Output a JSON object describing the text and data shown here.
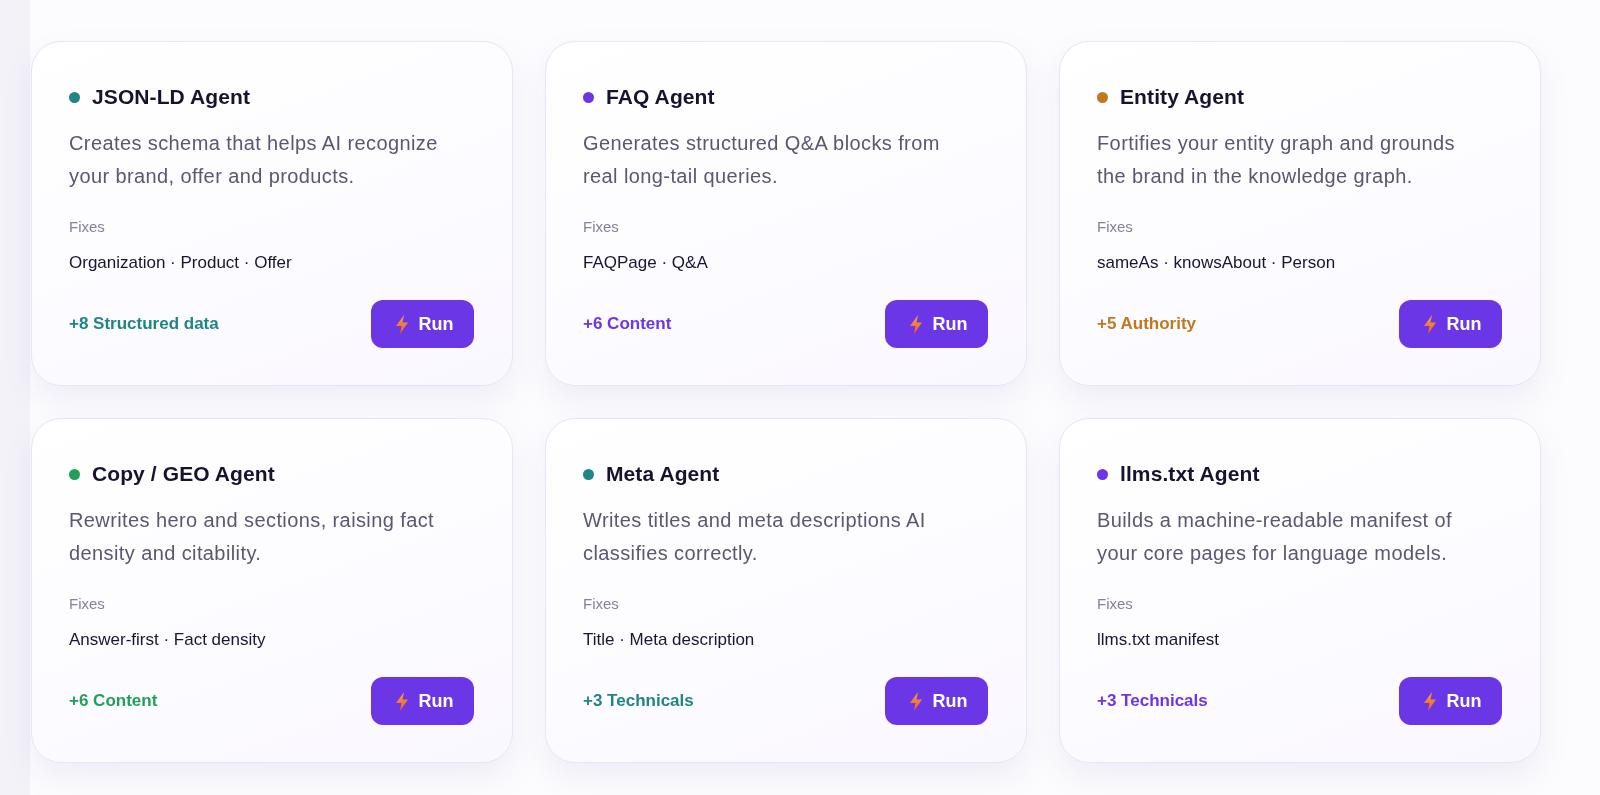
{
  "agents": [
    {
      "name": "JSON-LD Agent",
      "color": "#1f8585",
      "description": "Creates schema that helps AI recognize your brand, offer and products.",
      "fixes_label": "Fixes",
      "fixes": "Organization · Product · Offer",
      "impact": "+8 Structured data",
      "button": "Run"
    },
    {
      "name": "FAQ Agent",
      "color": "#6d35e8",
      "description": "Generates structured Q&A blocks from real long-tail queries.",
      "fixes_label": "Fixes",
      "fixes": "FAQPage · Q&A",
      "impact": "+6 Content",
      "button": "Run"
    },
    {
      "name": "Entity Agent",
      "color": "#c0781e",
      "description": "Fortifies your entity graph and grounds the brand in the knowledge graph.",
      "fixes_label": "Fixes",
      "fixes": "sameAs · knowsAbout · Person",
      "impact": "+5 Authority",
      "button": "Run"
    },
    {
      "name": "Copy / GEO Agent",
      "color": "#22a05a",
      "description": "Rewrites hero and sections, raising fact density and citability.",
      "fixes_label": "Fixes",
      "fixes": "Answer-first · Fact density",
      "impact": "+6 Content",
      "button": "Run"
    },
    {
      "name": "Meta Agent",
      "color": "#1f8585",
      "description": "Writes titles and meta descriptions AI classifies correctly.",
      "fixes_label": "Fixes",
      "fixes": "Title · Meta description",
      "impact": "+3 Technicals",
      "button": "Run"
    },
    {
      "name": "llms.txt Agent",
      "color": "#6d35e8",
      "description": "Builds a machine-readable manifest of your core pages for language models.",
      "fixes_label": "Fixes",
      "fixes": "llms.txt manifest",
      "impact": "+3 Technicals",
      "button": "Run"
    }
  ]
}
